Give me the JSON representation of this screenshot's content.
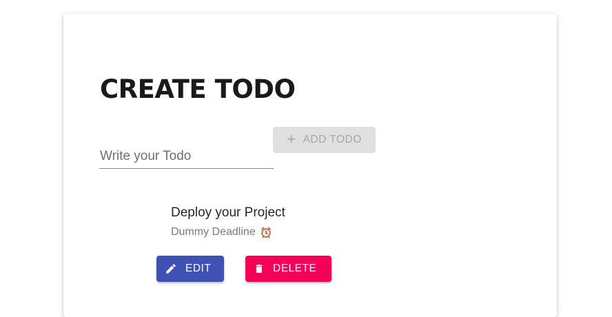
{
  "page": {
    "title": "CREATE TODO"
  },
  "form": {
    "input_value": "",
    "input_placeholder": "Write your Todo",
    "add_label": "ADD TODO"
  },
  "todos": [
    {
      "title": "Deploy your Project",
      "deadline": "Dummy Deadline",
      "deadline_icon": "alarm-clock-icon",
      "edit_label": "EDIT",
      "delete_label": "DELETE"
    }
  ],
  "colors": {
    "edit_button": "#3f51b5",
    "delete_button": "#f50057",
    "add_button_disabled": "#e0e0e0"
  },
  "icons": {
    "add": "plus-icon",
    "edit": "pencil-icon",
    "delete": "trash-icon"
  }
}
